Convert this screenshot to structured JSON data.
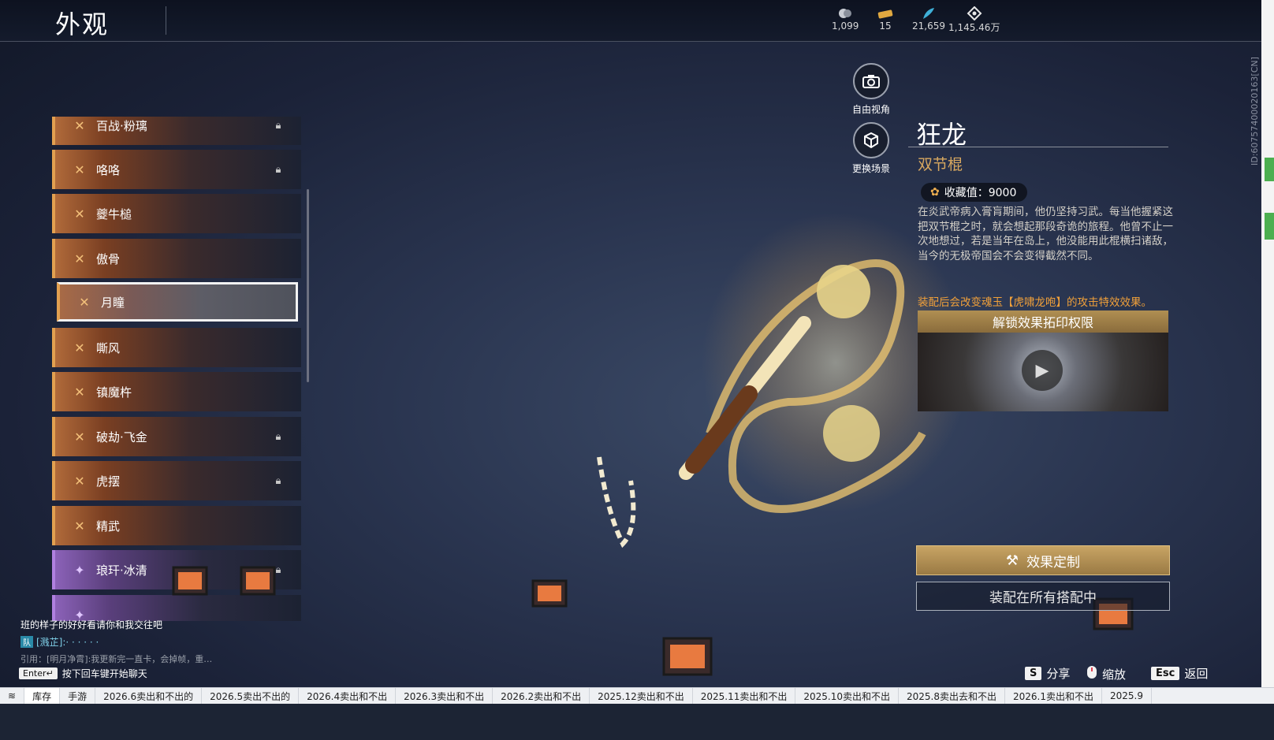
{
  "header": {
    "title": "外观",
    "currencies": [
      {
        "icon": "crystal-icon",
        "value": "1,099"
      },
      {
        "icon": "ticket-icon",
        "value": "15"
      },
      {
        "icon": "feather-icon",
        "value": "21,659"
      },
      {
        "icon": "diamond-icon",
        "value": "1,145.46万"
      }
    ],
    "side_id": "ID:60757400020163[CN]"
  },
  "camera": {
    "free_view": "自由视角",
    "change_scene": "更换场景"
  },
  "skins": [
    {
      "name": "百战·粉璃",
      "locked": true,
      "rarity": "orange"
    },
    {
      "name": "咯咯",
      "locked": true,
      "rarity": "orange"
    },
    {
      "name": "夔牛槌",
      "locked": false,
      "rarity": "orange"
    },
    {
      "name": "傲骨",
      "locked": false,
      "rarity": "orange"
    },
    {
      "name": "月瞳",
      "locked": false,
      "rarity": "orange",
      "selected": true
    },
    {
      "name": "嘶风",
      "locked": false,
      "rarity": "orange"
    },
    {
      "name": "镇魔杵",
      "locked": false,
      "rarity": "orange"
    },
    {
      "name": "破劫·飞金",
      "locked": true,
      "rarity": "orange"
    },
    {
      "name": "虎摆",
      "locked": true,
      "rarity": "orange"
    },
    {
      "name": "精武",
      "locked": false,
      "rarity": "orange"
    },
    {
      "name": "琅玕·冰清",
      "locked": true,
      "rarity": "purple"
    }
  ],
  "detail": {
    "name": "狂龙",
    "type": "双节棍",
    "collection_label": "收藏值：9000",
    "description": "在炎武帝病入膏肓期间，他仍坚持习武。每当他握紧这把双节棍之时，就会想起那段奇诡的旅程。他曾不止一次地想过，若是当年在岛上，他没能用此棍横扫诸敌，当今的无极帝国会不会变得截然不同。",
    "effect_note": "装配后会改变魂玉【虎啸龙咆】的攻击特效效果。",
    "unlock_banner": "解锁效果拓印权限"
  },
  "actions": {
    "customize": "效果定制",
    "equip_all": "装配在所有搭配中"
  },
  "chat": {
    "line1": "班的样子的好好看请你和我交往吧",
    "line2_tag": "队",
    "line2": "[溅芷]:· · · · · ·",
    "line3": "引用：[明月净霄]:我更新完一直卡，会掉帧，重…",
    "enter_key": "Enter↵",
    "hint": "按下回车键开始聊天"
  },
  "hotkeys": [
    {
      "key": "S",
      "label": "分享"
    },
    {
      "key": "",
      "label": "缩放",
      "icon": "mouse-icon"
    },
    {
      "key": "Esc",
      "label": "返回"
    }
  ],
  "browser_tabs": [
    "库存",
    "手游",
    "2026.6卖出和不出的",
    "2026.5卖出不出的",
    "2026.4卖出和不出",
    "2026.3卖出和不出",
    "2026.2卖出和不出",
    "2025.12卖出和不出",
    "2025.11卖出和不出",
    "2025.10卖出和不出",
    "2025.8卖出去和不出",
    "2026.1卖出和不出",
    "2025.9"
  ],
  "colors": {
    "accent_gold": "#d8a860",
    "effect_orange": "#f0a03a",
    "rarity_orange": "#e2a050",
    "rarity_purple": "#b080e0"
  }
}
